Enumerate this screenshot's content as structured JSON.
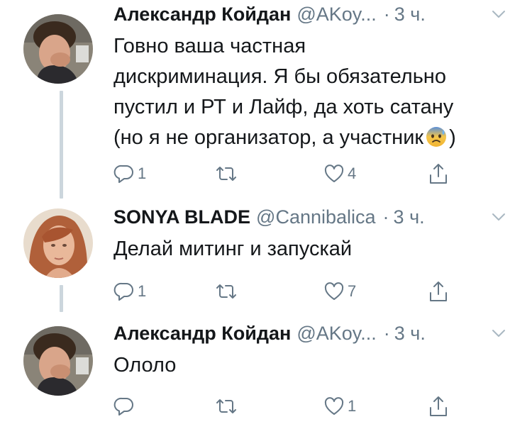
{
  "thread": {
    "tweets": [
      {
        "name": "Александр Койдан",
        "handle": "@AKoy...",
        "dot": "·",
        "time": "3 ч.",
        "text_lines": [
          "Говно ваша частная",
          "дискриминация. Я бы обязательно",
          "пустил и РТ и Лайф, да хоть сатану",
          "(но я не организатор, а участник"
        ],
        "text_tail": ")",
        "emoji_icon": "anxious-face-with-sweat-emoji",
        "reply_count": "1",
        "retweet_count": "",
        "like_count": "4"
      },
      {
        "name": "SONYA BLADE",
        "handle": "@Cannibalica",
        "dot": "·",
        "time": "3 ч.",
        "text_lines": [
          "Делай митинг и запускай"
        ],
        "reply_count": "1",
        "retweet_count": "",
        "like_count": "7"
      },
      {
        "name": "Александр Койдан",
        "handle": "@AKoy...",
        "dot": "·",
        "time": "3 ч.",
        "text_lines": [
          "Ололо"
        ],
        "reply_count": "",
        "retweet_count": "",
        "like_count": "1"
      }
    ]
  },
  "icons": {
    "reply": "reply-icon",
    "retweet": "retweet-icon",
    "like": "heart-icon",
    "share": "share-icon",
    "menu": "chevron-down-icon"
  },
  "colors": {
    "text": "#14171a",
    "secondary": "#657786",
    "thread_line": "#ccd6dd"
  }
}
